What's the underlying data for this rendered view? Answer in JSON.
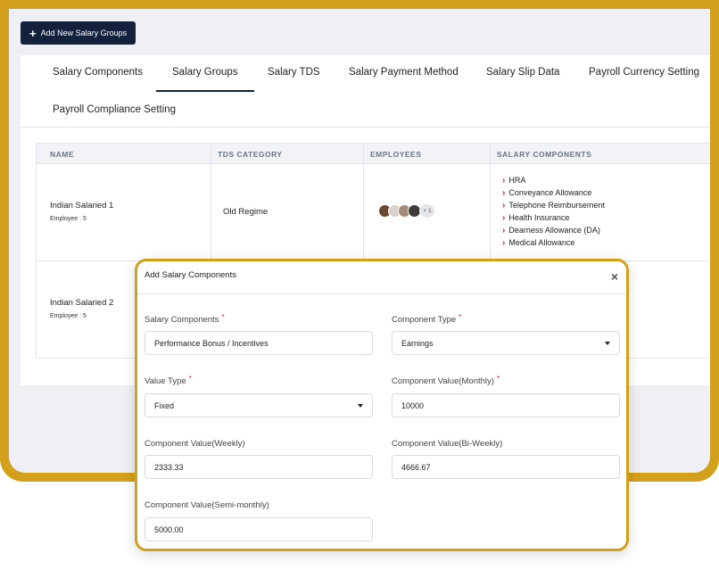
{
  "toolbar": {
    "add_button_label": "Add New Salary Groups"
  },
  "tabs": [
    {
      "label": "Salary Components",
      "active": false
    },
    {
      "label": "Salary Groups",
      "active": true
    },
    {
      "label": "Salary TDS",
      "active": false
    },
    {
      "label": "Salary Payment Method",
      "active": false
    },
    {
      "label": "Salary Slip Data",
      "active": false
    },
    {
      "label": "Payroll Currency Setting",
      "active": false
    },
    {
      "label": "Payroll Compliance Setting",
      "active": false
    }
  ],
  "table": {
    "headers": [
      "NAME",
      "TDS CATEGORY",
      "EMPLOYEES",
      "SALARY COMPONENTS"
    ],
    "rows": [
      {
        "name": "Indian Salaried 1",
        "employee_count": "Employee : 5",
        "tds_category": "Old Regime",
        "more_avatars": "+ 1",
        "components": [
          "HRA",
          "Conveyance Allowance",
          "Telephone Reimbursement",
          "Health Insurance",
          "Dearness Allowance (DA)",
          "Medical Allowance"
        ]
      },
      {
        "name": "Indian Salaried 2",
        "employee_count": "Employee : 5"
      }
    ]
  },
  "modal": {
    "title": "Add Salary Components",
    "fields": {
      "salary_components": {
        "label": "Salary Components",
        "value": "Performance Bonus / Incentives",
        "required": "*"
      },
      "component_type": {
        "label": "Component Type",
        "value": "Earnings",
        "required": "*"
      },
      "value_type": {
        "label": "Value Type",
        "value": "Fixed",
        "required": "*"
      },
      "monthly": {
        "label": "Component Value(Monthly)",
        "value": "10000",
        "required": "*"
      },
      "weekly": {
        "label": "Component Value(Weekly)",
        "value": "2333.33"
      },
      "biweekly": {
        "label": "Component Value(Bi-Weekly)",
        "value": "4666.67"
      },
      "semimonthly": {
        "label": "Component Value(Semi-monthly)",
        "value": "5000.00"
      }
    }
  },
  "colors": {
    "accent_gold": "#d4a01c",
    "navy": "#14213d",
    "chevron_red": "#c0262d"
  }
}
